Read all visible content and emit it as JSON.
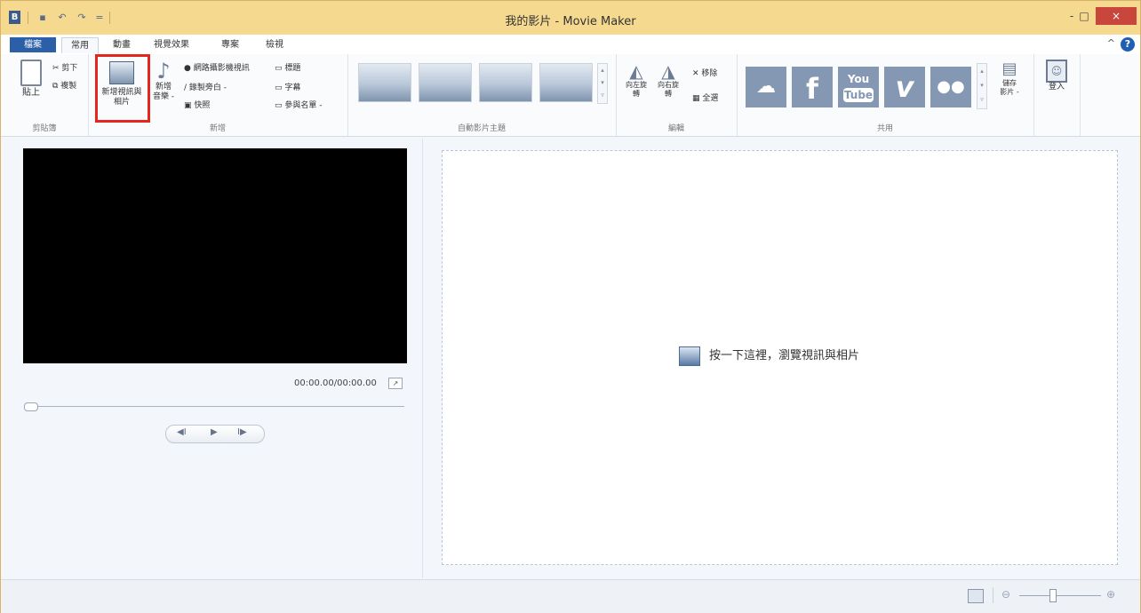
{
  "window": {
    "title": "我的影片 - Movie Maker",
    "app_icon_glyph": "B",
    "controls": {
      "minimize": "-",
      "maximize": "□",
      "close": "×"
    }
  },
  "quick_access": [
    {
      "name": "save-icon",
      "glyph": "▪"
    },
    {
      "name": "undo-icon",
      "glyph": "↶"
    },
    {
      "name": "redo-icon",
      "glyph": "↷"
    },
    {
      "name": "customize-icon",
      "glyph": "="
    }
  ],
  "tabs": [
    "檔案",
    "常用",
    "動畫",
    "視覺效果",
    "專案",
    "檢視"
  ],
  "ribbon": {
    "clipboard": {
      "paste": "貼上",
      "cut": "剪下",
      "copy": "複製",
      "label": "剪貼簿"
    },
    "add": {
      "add_videos_photos": "新增視訊與相片",
      "add_music_line1": "新增",
      "add_music_line2": "音樂 -",
      "webcam": "網路攝影機視訊",
      "narration": "錄製旁白 -",
      "snapshot": "快照",
      "title": "標題",
      "caption": "字幕",
      "credits": "參與名單 -",
      "label": "新增"
    },
    "themes": {
      "label": "自動影片主題"
    },
    "editing": {
      "rotate_left": "向左旋轉",
      "rotate_right": "向右旋轉",
      "remove": "移除",
      "select_all": "全選",
      "label": "編輯"
    },
    "share": {
      "save_movie_line1": "儲存",
      "save_movie_line2": "影片 -",
      "sign_in": "登入",
      "label": "共用",
      "youtube_top": "You",
      "youtube_bottom": "Tube",
      "facebook": "f",
      "vimeo": "v",
      "flickr": "●●"
    }
  },
  "preview": {
    "timecode": "00:00.00/00:00.00",
    "prev_frame": "◀I",
    "play": "▶",
    "next_frame": "I▶"
  },
  "storyboard": {
    "hint": "按一下這裡，瀏覽視訊與相片"
  },
  "status": {
    "zoom_out": "⊖",
    "zoom_in": "⊕"
  }
}
